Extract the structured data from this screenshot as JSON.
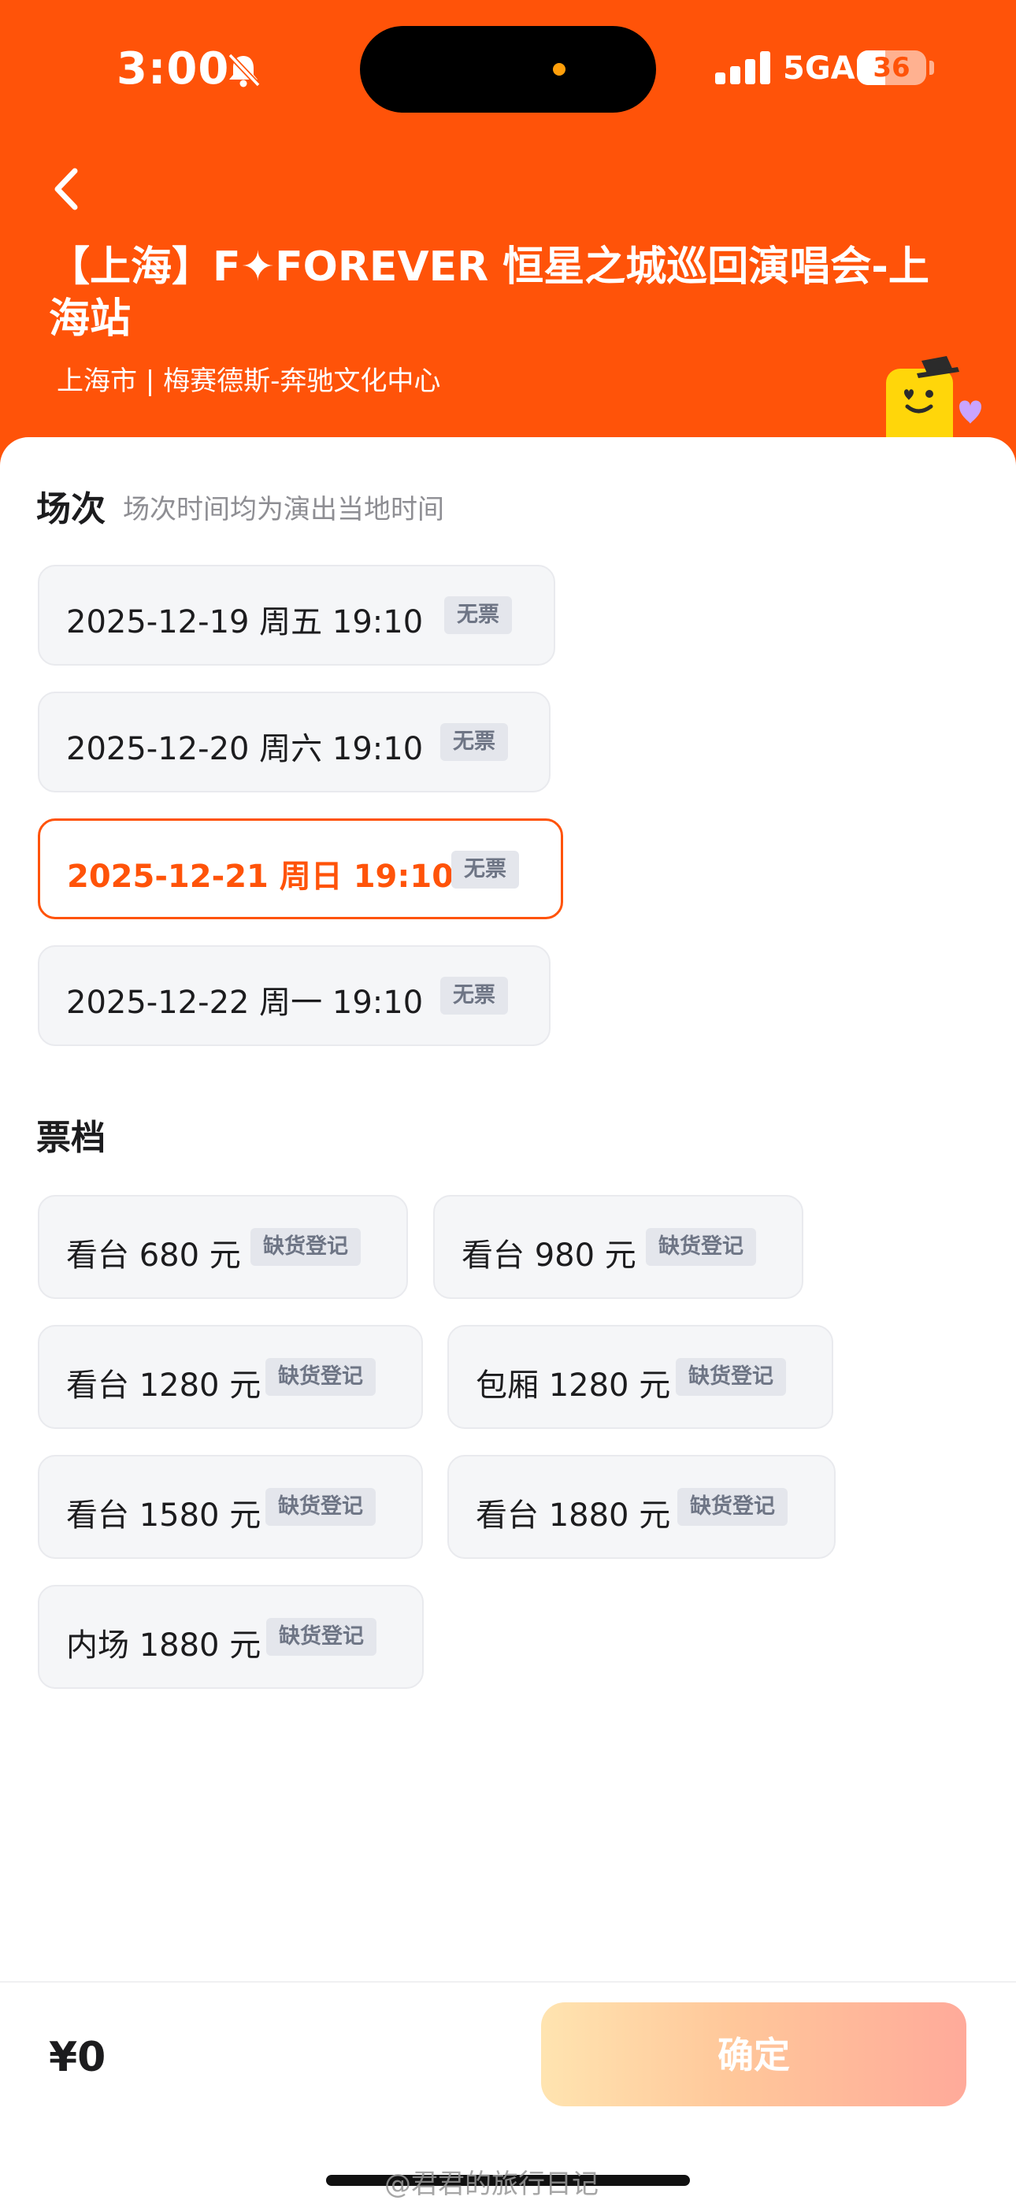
{
  "status_bar": {
    "time": "3:00",
    "network": "5GA",
    "battery": "36"
  },
  "header": {
    "title": "【上海】F✦FOREVER 恒星之城巡回演唱会-上海站",
    "subtitle": "上海市 | 梅赛德斯-奔驰文化中心"
  },
  "sessions": {
    "title": "场次",
    "note": "场次时间均为演出当地时间",
    "items": [
      {
        "label": "2025-12-19  周五 19:10",
        "tag": "无票"
      },
      {
        "label": "2025-12-20 周六 19:10",
        "tag": "无票"
      },
      {
        "label": "2025-12-21 周日 19:10",
        "tag": "无票"
      },
      {
        "label": "2025-12-22 周一 19:10",
        "tag": "无票"
      }
    ]
  },
  "tiers": {
    "title": "票档",
    "items": [
      {
        "label": "看台 680 元",
        "tag": "缺货登记"
      },
      {
        "label": "看台 980 元",
        "tag": "缺货登记"
      },
      {
        "label": "看台 1280 元",
        "tag": "缺货登记"
      },
      {
        "label": "包厢 1280 元",
        "tag": "缺货登记"
      },
      {
        "label": "看台 1580 元",
        "tag": "缺货登记"
      },
      {
        "label": "看台 1880 元",
        "tag": "缺货登记"
      },
      {
        "label": "内场 1880 元",
        "tag": "缺货登记"
      }
    ]
  },
  "footer": {
    "price": "¥0",
    "confirm_label": "确定",
    "watermark": "@君君的旅行日记"
  },
  "colors": {
    "brand": "#ff5309",
    "tag_bg": "#e4e6ec",
    "tag_text": "#6e7585"
  }
}
